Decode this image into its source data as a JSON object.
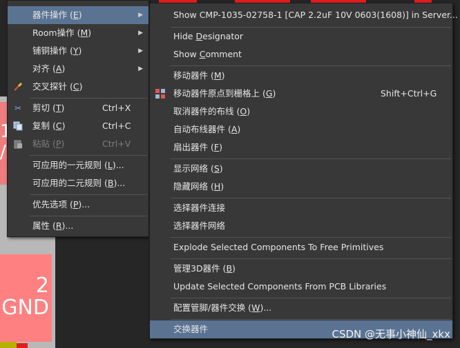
{
  "canvas": {
    "pad_top_text": "1\n/",
    "pad_bottom_text": "2\nGND"
  },
  "left_menu": {
    "items": [
      {
        "label": "",
        "shortcut": "",
        "arrow": "",
        "highlight": false
      },
      {
        "label": "器件操作 (",
        "u": "E",
        "end": ")",
        "arrow": "▶",
        "highlight": true
      },
      {
        "label": "Room操作 (",
        "u": "M",
        "end": ")",
        "arrow": "▶"
      },
      {
        "label": "铺铜操作 (",
        "u": "Y",
        "end": ")",
        "arrow": "▶"
      },
      {
        "label": "对齐 (",
        "u": "A",
        "end": ")",
        "arrow": "▶"
      },
      {
        "label": "交叉探针 (",
        "u": "C",
        "end": ")",
        "icon": "probe-icon"
      },
      {
        "label": "剪切 (",
        "u": "T",
        "end": ")",
        "shortcut": "Ctrl+X",
        "icon": "scissors-icon"
      },
      {
        "label": "复制 (",
        "u": "C",
        "end": ")",
        "shortcut": "Ctrl+C",
        "icon": "copy-icon"
      },
      {
        "label": "粘贴 (",
        "u": "P",
        "end": ")",
        "shortcut": "Ctrl+V",
        "icon": "paste-icon",
        "disabled": true
      },
      {
        "label": "可应用的一元规则 (",
        "u": "L",
        "end": ")..."
      },
      {
        "label": "可应用的二元规则 (",
        "u": "B",
        "end": ")..."
      },
      {
        "label": "优先选项 (",
        "u": "P",
        "end": ")..."
      },
      {
        "label": "属性 (",
        "u": "R",
        "end": ")..."
      }
    ]
  },
  "right_menu": {
    "items": [
      {
        "label": "Show CMP-1035-02758-1 [CAP 2.2uF 10V 0603(1608)] in Server..."
      },
      {
        "pre": "Hide ",
        "u": "D",
        "label": "esignator"
      },
      {
        "pre": "Show ",
        "u": "C",
        "label": "omment"
      },
      {
        "label": "移动器件 (",
        "u": "M",
        "end": ")"
      },
      {
        "label": "移动器件原点到栅格上 (",
        "u": "G",
        "end": ")",
        "shortcut": "Shift+Ctrl+G",
        "icon": "grid-origin-icon"
      },
      {
        "label": "取消器件的布线 (",
        "u": "O",
        "end": ")"
      },
      {
        "label": "自动布线器件 (",
        "u": "A",
        "end": ")"
      },
      {
        "label": "扇出器件 (",
        "u": "F",
        "end": ")"
      },
      {
        "label": "显示网络 (",
        "u": "S",
        "end": ")"
      },
      {
        "label": "隐藏网络 (",
        "u": "H",
        "end": ")"
      },
      {
        "label": "选择器件连接"
      },
      {
        "label": "选择器件网络"
      },
      {
        "label": "Explode Selected Components To Free Primitives"
      },
      {
        "label": "管理3D器件 (",
        "u": "B",
        "end": ")"
      },
      {
        "label": "Update Selected Components From PCB Libraries"
      },
      {
        "label": "配置管脚/器件交换 (",
        "u": "W",
        "end": ")..."
      },
      {
        "label": "交换器件",
        "highlight": true
      }
    ]
  },
  "watermark": "CSDN @无事小神仙_xkx"
}
